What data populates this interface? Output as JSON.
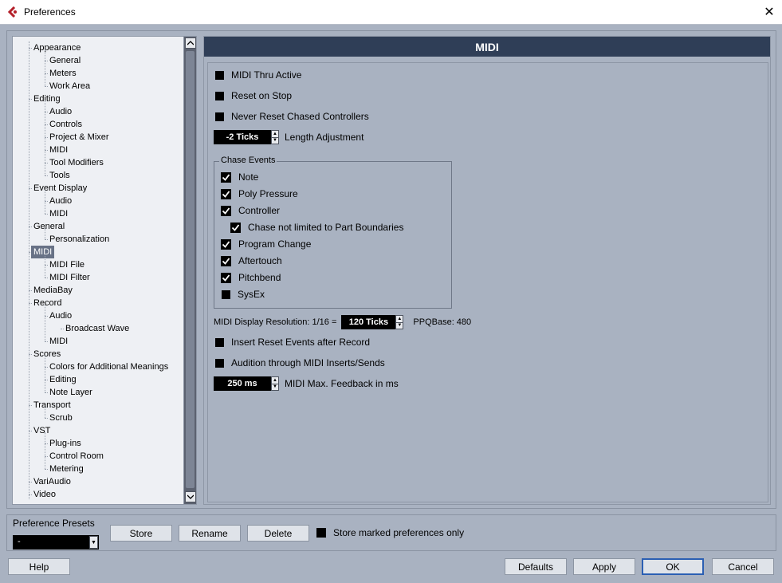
{
  "window": {
    "title": "Preferences",
    "close_glyph": "✕"
  },
  "tree": {
    "items": [
      {
        "label": "Appearance",
        "level": 1
      },
      {
        "label": "General",
        "level": 2
      },
      {
        "label": "Meters",
        "level": 2
      },
      {
        "label": "Work Area",
        "level": 2
      },
      {
        "label": "Editing",
        "level": 1
      },
      {
        "label": "Audio",
        "level": 2
      },
      {
        "label": "Controls",
        "level": 2
      },
      {
        "label": "Project & Mixer",
        "level": 2
      },
      {
        "label": "MIDI",
        "level": 2
      },
      {
        "label": "Tool Modifiers",
        "level": 2
      },
      {
        "label": "Tools",
        "level": 2
      },
      {
        "label": "Event Display",
        "level": 1
      },
      {
        "label": "Audio",
        "level": 2
      },
      {
        "label": "MIDI",
        "level": 2
      },
      {
        "label": "General",
        "level": 1
      },
      {
        "label": "Personalization",
        "level": 2
      },
      {
        "label": "MIDI",
        "level": 1,
        "selected": true
      },
      {
        "label": "MIDI File",
        "level": 2
      },
      {
        "label": "MIDI Filter",
        "level": 2
      },
      {
        "label": "MediaBay",
        "level": 1
      },
      {
        "label": "Record",
        "level": 1
      },
      {
        "label": "Audio",
        "level": 2
      },
      {
        "label": "Broadcast Wave",
        "level": 3
      },
      {
        "label": "MIDI",
        "level": 2
      },
      {
        "label": "Scores",
        "level": 1
      },
      {
        "label": "Colors for Additional Meanings",
        "level": 2
      },
      {
        "label": "Editing",
        "level": 2
      },
      {
        "label": "Note Layer",
        "level": 2
      },
      {
        "label": "Transport",
        "level": 1
      },
      {
        "label": "Scrub",
        "level": 2
      },
      {
        "label": "VST",
        "level": 1
      },
      {
        "label": "Plug-ins",
        "level": 2
      },
      {
        "label": "Control Room",
        "level": 2
      },
      {
        "label": "Metering",
        "level": 2
      },
      {
        "label": "VariAudio",
        "level": 1
      },
      {
        "label": "Video",
        "level": 1
      }
    ]
  },
  "midi": {
    "header": "MIDI",
    "thru_active": "MIDI Thru Active",
    "reset_on_stop": "Reset on Stop",
    "never_reset": "Never Reset Chased Controllers",
    "length_adj_value": "-2 Ticks",
    "length_adj_label": "Length Adjustment",
    "chase": {
      "title": "Chase Events",
      "note": "Note",
      "poly_pressure": "Poly Pressure",
      "controller": "Controller",
      "chase_not_limited": "Chase not limited to Part Boundaries",
      "program_change": "Program Change",
      "aftertouch": "Aftertouch",
      "pitchbend": "Pitchbend",
      "sysex": "SysEx"
    },
    "display_res_label": "MIDI Display Resolution: 1/16 =",
    "display_res_value": "120 Ticks",
    "ppq_base": "PPQBase: 480",
    "insert_reset": "Insert Reset Events after Record",
    "audition": "Audition through MIDI Inserts/Sends",
    "feedback_value": "250 ms",
    "feedback_label": "MIDI Max. Feedback in ms"
  },
  "presets": {
    "label": "Preference Presets",
    "selected": "-",
    "store": "Store",
    "rename": "Rename",
    "delete": "Delete",
    "store_marked": "Store marked preferences only"
  },
  "footer": {
    "help": "Help",
    "defaults": "Defaults",
    "apply": "Apply",
    "ok": "OK",
    "cancel": "Cancel"
  },
  "colors": {
    "header_bg": "#2f3e57",
    "panel_bg": "#a9b2c1",
    "selection": "#687286",
    "focus": "#2b5fb3"
  }
}
